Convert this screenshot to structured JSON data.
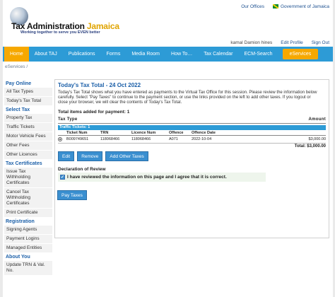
{
  "header": {
    "links": [
      "Our Offices",
      "Government of Jamaica"
    ],
    "logo_title_main": "Tax Administration",
    "logo_title_accent": " Jamaica",
    "tagline": "Working together to serve you EVEN better",
    "user_name": "kamal Damion hines",
    "edit_profile": "Edit Profile",
    "sign_out": "Sign Out"
  },
  "nav": {
    "items": [
      "Home",
      "About TAJ",
      "Publications",
      "Forms",
      "Media Room",
      "How To…",
      "Tax Calendar",
      "ECM-Search"
    ],
    "eservices": "eServices"
  },
  "breadcrumb": "eServices /",
  "sidebar": {
    "pay_online": "Pay Online",
    "pay_items": [
      "All Tax Types",
      "Today's Tax Total"
    ],
    "select_tax": "Select Tax",
    "tax_items": [
      "Property Tax",
      "Traffic Tickets",
      "Motor Vehicle Fees",
      "Other Fees",
      "Other Licences"
    ],
    "tax_certificates": "Tax Certificates",
    "cert_items": [
      "Issue Tax Withholding Certificates",
      "Cancel Tax Withholding Certificates",
      "Print Certificate"
    ],
    "registration": "Registration",
    "reg_items": [
      "Signing Agents",
      "Payment Logins",
      "Managed Entities"
    ],
    "about_you": "About You",
    "about_items": [
      "Update TRN & Val. No."
    ]
  },
  "main": {
    "title": "Today's Tax Total - 24 Oct 2022",
    "description": "Today's Tax Total shows what you have entered as payments to the Virtual Tax Office for this session. Please review the information below carefully. Select \"Pay Taxes\" to continue to the payment section, or use the links provided on the left to add other taxes. If you logout or close your browser, we will clear the contents of Today's Tax Total.",
    "total_items": "Total items added for payment: 1",
    "tax_type_header": "Tax Type",
    "amount_header": "Amount",
    "band_label": "Traffic Tickets: 1",
    "columns": [
      "",
      "Ticket Num",
      "TRN",
      "Licence Num",
      "Offence",
      "Offence Date",
      ""
    ],
    "row": {
      "ticket_num": "B009749651",
      "trn": "118068466",
      "licence_num": "118068466",
      "offence": "A071",
      "offence_date": "2022-10-04",
      "amount": "$3,000.00"
    },
    "subtotal": "Total: $3,000.00",
    "buttons": {
      "edit": "Edit",
      "remove": "Remove",
      "add_other": "Add Other Taxes"
    },
    "declaration_title": "Declaration of Review",
    "declaration_text": "I have reviewed the information on this page and I agree that it is correct.",
    "declaration_checked": true,
    "pay_button": "Pay Taxes"
  },
  "colors": {
    "nav_blue": "#2d9bd6",
    "accent_orange": "#f6a800",
    "link_blue": "#1b5fa8"
  }
}
